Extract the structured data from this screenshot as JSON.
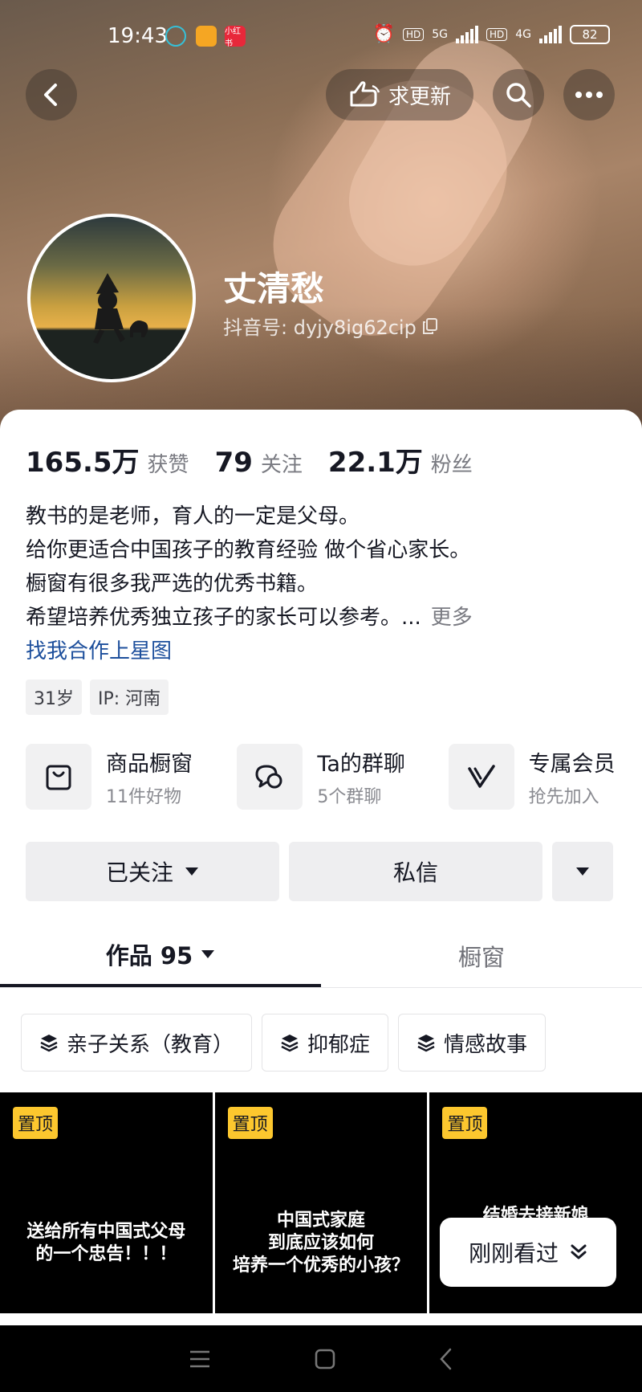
{
  "status_bar": {
    "time": "19:43",
    "app3_label": "小红书",
    "net1": "5G",
    "net2": "4G",
    "hd": "HD",
    "battery": "82"
  },
  "top_nav": {
    "request_update_label": "求更新"
  },
  "profile": {
    "name": "丈清愁",
    "douyin_id": "抖音号: dyjy8ig62cip"
  },
  "stats": [
    {
      "num": "165.5万",
      "label": "获赞"
    },
    {
      "num": "79",
      "label": "关注"
    },
    {
      "num": "22.1万",
      "label": "粉丝"
    }
  ],
  "bio": {
    "lines": [
      "教书的是老师，育人的一定是父母。",
      "给你更适合中国孩子的教育经验 做个省心家长。",
      "橱窗有很多我严选的优秀书籍。",
      "希望培养优秀独立孩子的家长可以参考。..."
    ],
    "more": "更多",
    "link": "找我合作上星图"
  },
  "tags": [
    "31岁",
    "IP: 河南"
  ],
  "features": [
    {
      "title": "商品橱窗",
      "sub": "11件好物",
      "icon": "bag-icon"
    },
    {
      "title": "Ta的群聊",
      "sub": "5个群聊",
      "icon": "chat-icon"
    },
    {
      "title": "专属会员",
      "sub": "抢先加入",
      "icon": "v-icon"
    }
  ],
  "actions": {
    "followed": "已关注",
    "message": "私信"
  },
  "tabs": {
    "works": "作品 95",
    "showcase": "橱窗"
  },
  "collections": [
    "亲子关系（教育）",
    "抑郁症",
    "情感故事"
  ],
  "videos": [
    {
      "pin": "置顶",
      "text": "送给所有中国式父母\n的一个忠告！！！"
    },
    {
      "pin": "置顶",
      "text": "中国式家庭\n到底应该如何\n培养一个优秀的小孩？"
    },
    {
      "pin": "置顶",
      "text": "结婚去接新娘"
    }
  ],
  "recent_button": "刚刚看过",
  "colors": {
    "link": "#1d4f9c",
    "pin": "#fcc72e",
    "text": "#161823"
  }
}
